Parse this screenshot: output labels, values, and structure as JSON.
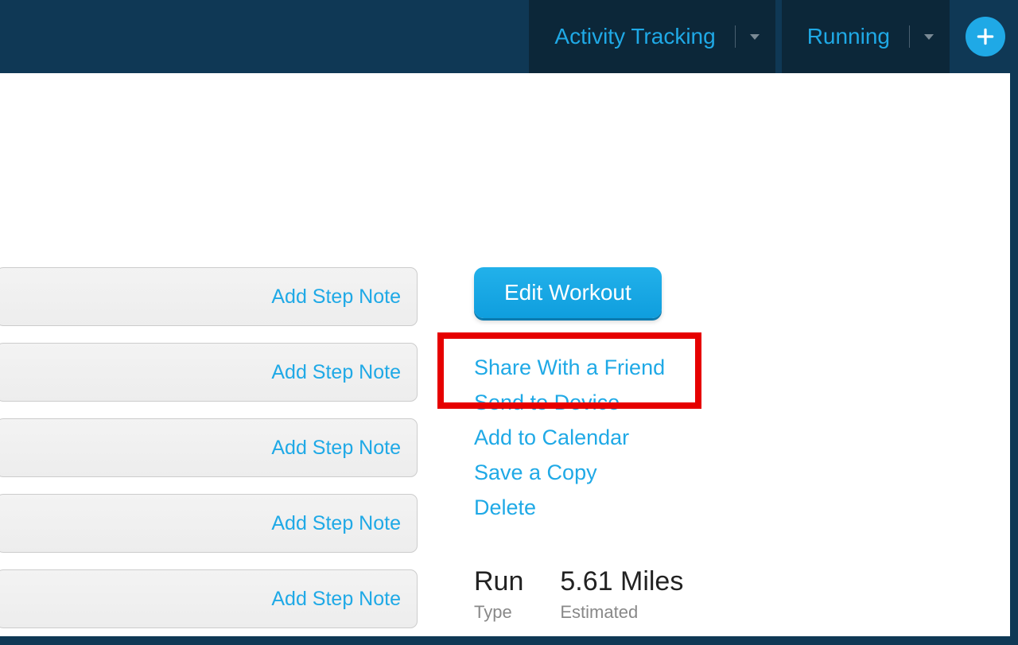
{
  "nav": {
    "activity_tracking": "Activity Tracking",
    "running": "Running"
  },
  "steps": [
    {
      "label": "Add Step Note"
    },
    {
      "label": "Add Step Note"
    },
    {
      "label": "Add Step Note"
    },
    {
      "label": "Add Step Note"
    },
    {
      "label": "Add Step Note"
    }
  ],
  "actions": {
    "edit_label": "Edit Workout",
    "links": {
      "share": "Share With a Friend",
      "send": "Send to Device",
      "calendar": "Add to Calendar",
      "copy": "Save a Copy",
      "delete": "Delete"
    }
  },
  "stats": {
    "type_value": "Run",
    "type_label": "Type",
    "distance_value": "5.61 Miles",
    "distance_label": "Estimated"
  }
}
